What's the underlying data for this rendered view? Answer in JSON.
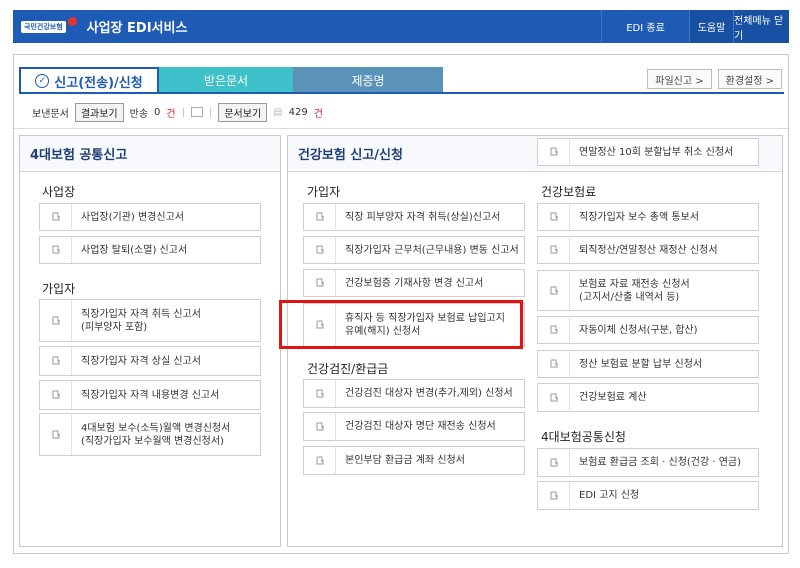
{
  "header": {
    "logo_text": "국민건강보험",
    "title": "사업장 EDI서비스",
    "edi_end": "EDI 종료",
    "help": "도움말",
    "close_all": "전체메뉴 닫기"
  },
  "tabs": {
    "send": "신고(전송)/신청",
    "received": "받은문서",
    "cert": "제증명"
  },
  "links": {
    "file_report": "파일신고 >",
    "settings": "환경설정 >"
  },
  "status": {
    "sent_label": "보낸문서",
    "result_btn": "결과보기",
    "return_label": "반송",
    "return_count": "0",
    "unit": "건",
    "doc_btn": "문서보기",
    "doc_count": "429",
    "doc_unit": "건"
  },
  "left": {
    "title": "4대보험 공통신고",
    "sec_workplace": "사업장",
    "workplace_items": [
      "사업장(기관) 변경신고서",
      "사업장 탈퇴(소멸) 신고서"
    ],
    "sec_member": "가입자",
    "member_items": [
      [
        "직장가입자 자격 취득 신고서",
        "(피부양자 포함)"
      ],
      [
        "직장가입자 자격 상실 신고서"
      ],
      [
        "직장가입자 자격 내용변경 신고서"
      ],
      [
        "4대보험 보수(소득)월액 변경신청서",
        "(직장가입자 보수월액 변경신청서)"
      ]
    ]
  },
  "right": {
    "title": "건강보험 신고/신청",
    "top_item": "연말정산 10회 분할납부 취소 신청서",
    "sec_member": "가입자",
    "member_items": [
      [
        "직장 피부양자 자격 취득(상실)신고서"
      ],
      [
        "직장가입자 근무처(근무내용) 변동 신고서"
      ],
      [
        "건강보험증 기재사항 변경 신고서"
      ],
      [
        "휴직자 등 직장가입자 보험료 납입고지",
        "유예(해지) 신청서"
      ]
    ],
    "sec_checkup": "건강검진/환급금",
    "checkup_items": [
      "건강검진 대상자 변경(추가,제외) 신청서",
      "건강검진 대상자 명단 재전송 신청서",
      "본인부담 환급금 계좌 신청서"
    ],
    "sec_premium": "건강보험료",
    "premium_items": [
      [
        "직장가입자 보수 총액 통보서"
      ],
      [
        "퇴직정산/연말정산 재정산 신청서"
      ],
      [
        "보험료 자료 재전송 신청서",
        "(고지서/산출 내역서 등)"
      ],
      [
        "자동이체 신청서(구분, 합산)"
      ],
      [
        "정산 보험료 분할 납부 신청서"
      ],
      [
        "건강보험료 계산"
      ]
    ],
    "sec_common": "4대보험공통신청",
    "common_items": [
      "보험료 환급금 조회 · 신청(건강 · 연금)",
      "EDI 고지 신청"
    ]
  }
}
